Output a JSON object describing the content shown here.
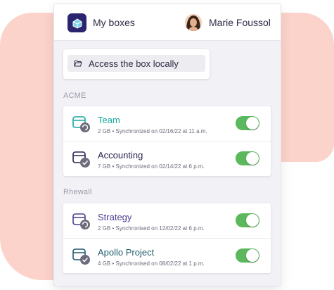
{
  "header": {
    "app_title": "My boxes",
    "user_name": "Marie Foussol"
  },
  "access": {
    "label": "Access the box locally",
    "icon": "folder-open-icon"
  },
  "groups": [
    {
      "label": "ACME",
      "items": [
        {
          "title": "Team",
          "meta": "2 GB • Synchronized on 02/16/22 at 11 a.m.",
          "color": "#1aa6a1",
          "enabled": true
        },
        {
          "title": "Accounting",
          "meta": "7 GB • Synchronized on 02/14/22 at 6 p.m.",
          "color": "#2b2150",
          "enabled": true
        }
      ]
    },
    {
      "label": "Rhewall",
      "items": [
        {
          "title": "Strategy",
          "meta": "2 GB • Synchronised on 12/02/22 at 6 p.m.",
          "color": "#4a3f8f",
          "enabled": true
        },
        {
          "title": "Apollo Project",
          "meta": "4 GB • Synchronised on 08/02/22 at 1 p.m.",
          "color": "#1f5c6e",
          "enabled": true
        }
      ]
    }
  ],
  "colors": {
    "accent_bg": "#fcd3cb",
    "toggle_on": "#5cb85c",
    "app_icon": "#2b2570"
  }
}
